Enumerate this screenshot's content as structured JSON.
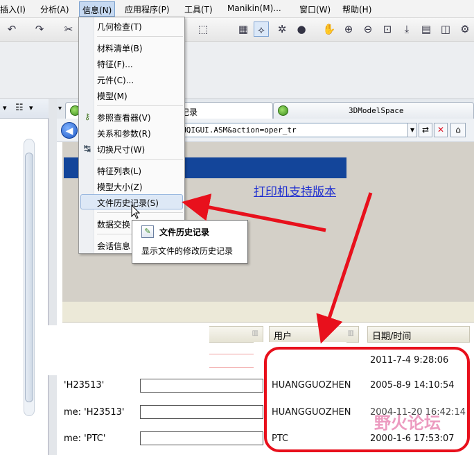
{
  "menubar": {
    "items": [
      "插入(I)",
      "分析(A)",
      "信息(N)",
      "应用程序(P)",
      "工具(T)",
      "Manikin(M)...",
      "窗口(W)",
      "帮助(H)"
    ]
  },
  "info_menu": {
    "items": [
      "几何检查(T)",
      "材料清单(B)",
      "特征(F)...",
      "元件(C)...",
      "模型(M)",
      "参照查看器(V)",
      "关系和参数(R)",
      "切换尺寸(W)",
      "特征列表(L)",
      "模型大小(Z)",
      "文件历史记录(S)",
      "数据交换",
      "会话信息"
    ]
  },
  "tooltip": {
    "title": "文件历史记录",
    "description": "显示文件的修改历史记录"
  },
  "tabs": {
    "tab1": "记录",
    "tab2": "3DModelSpace"
  },
  "address": {
    "url": "l_proesession?oid=DIANQIGUI.ASM&action=oper_tr"
  },
  "page": {
    "print_link": "打印机支持版本"
  },
  "table": {
    "col_user": "用户",
    "col_date": "日期/时间",
    "left_labels": [
      "'H23513'",
      "me: 'H23513'",
      "me: 'PTC'"
    ],
    "rows": [
      {
        "user": "",
        "date": "2011-7-4 9:28:06"
      },
      {
        "user": "HUANGGUOZHEN",
        "date": "2005-8-9 14:10:54"
      },
      {
        "user": "HUANGGUOZHEN",
        "date": "2004-11-20 16:42:14"
      },
      {
        "user": "PTC",
        "date": "2000-1-6 17:53:07"
      }
    ]
  },
  "watermark": {
    "text": "野火论坛"
  },
  "colors": {
    "banner": "#13459a",
    "annotation_red": "#e8101c",
    "link": "#1f2fd0"
  }
}
